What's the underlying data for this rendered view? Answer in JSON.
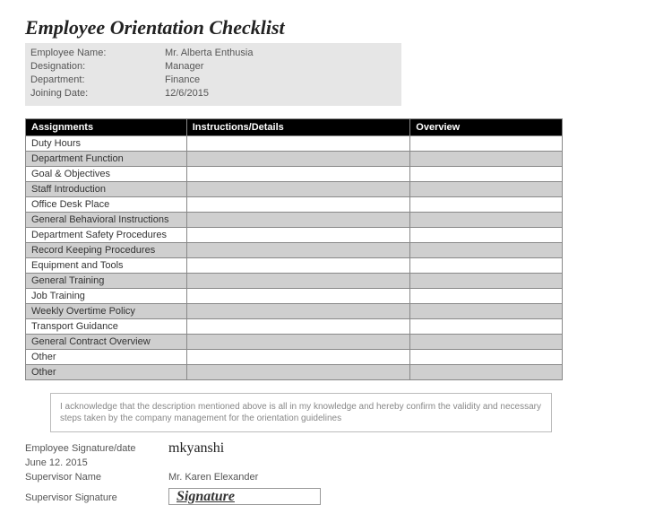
{
  "title": "Employee Orientation Checklist",
  "info": {
    "labels": {
      "name": "Employee Name:",
      "designation": "Designation:",
      "department": "Department:",
      "joining": "Joining Date:"
    },
    "values": {
      "name": "Mr. Alberta Enthusia",
      "designation": "Manager",
      "department": "Finance",
      "joining": "12/6/2015"
    }
  },
  "columns": {
    "c1": "Assignments",
    "c2": "Instructions/Details",
    "c3": "Overview"
  },
  "rows": [
    "Duty Hours",
    "Department Function",
    "Goal & Objectives",
    "Staff Introduction",
    "Office Desk Place",
    "General Behavioral Instructions",
    "Department Safety Procedures",
    "Record Keeping Procedures",
    "Equipment and Tools",
    "General Training",
    "Job Training",
    "Weekly Overtime Policy",
    "Transport Guidance",
    "General Contract Overview",
    "Other",
    "Other"
  ],
  "ack": "I acknowledge that the description mentioned above is all in my knowledge and hereby confirm the validity and necessary steps taken by the company management for the orientation guidelines",
  "sig": {
    "emp_label": "Employee Signature/date",
    "emp_date": "June 12. 2015",
    "emp_script": "mkyanshi",
    "sup_name_label": "Supervisor Name",
    "sup_name": "Mr. Karen Elexander",
    "sup_sig_label": "Supervisor Signature",
    "sup_sig": "Signature"
  }
}
